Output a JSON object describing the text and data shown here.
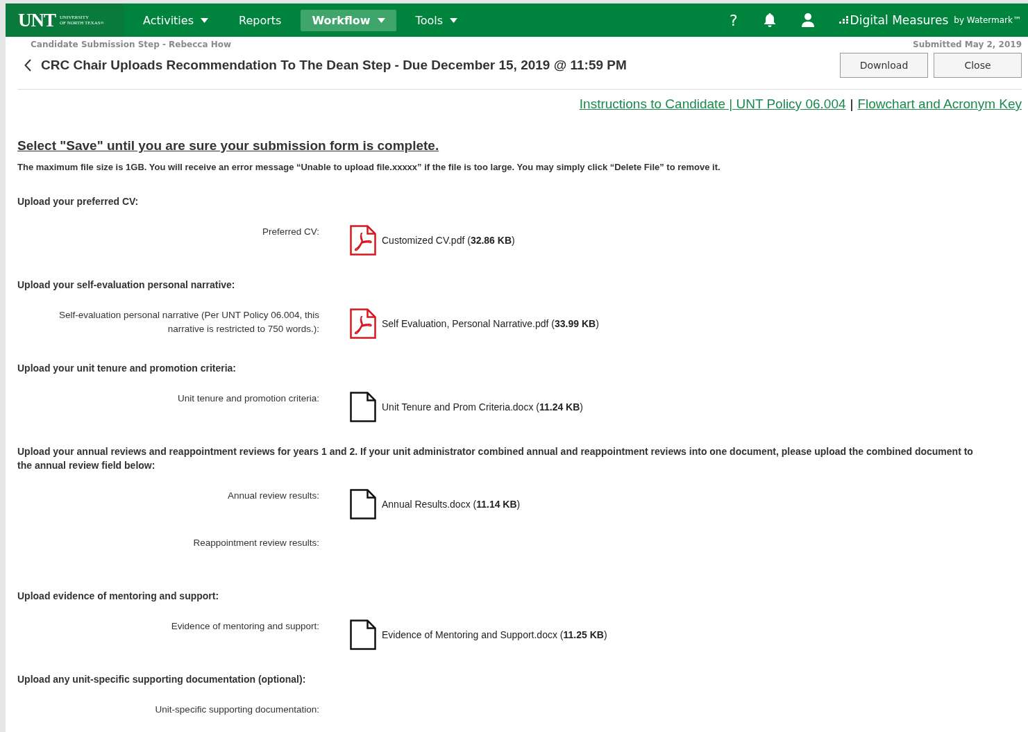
{
  "nav": {
    "logo": {
      "mark": "UNT",
      "line_1": "UNIVERSITY",
      "line_2": "OF NORTH TEXAS®"
    },
    "menu": [
      {
        "label": "Activities",
        "dropdown": true,
        "selected": false
      },
      {
        "label": "Reports",
        "dropdown": false,
        "selected": false
      },
      {
        "label": "Workflow",
        "dropdown": true,
        "selected": true
      },
      {
        "label": "Tools",
        "dropdown": true,
        "selected": false
      }
    ],
    "help": "?",
    "brand": "Digital Measures",
    "brand_by": "by Watermark™"
  },
  "header": {
    "previous_step": "Candidate Submission Step - Rebecca How",
    "submitted": "Submitted May 2, 2019",
    "title": "CRC Chair Uploads Recommendation To The Dean Step - Due December 15, 2019 @ 11:59 PM",
    "buttons": [
      "Download",
      "Close"
    ]
  },
  "links": [
    {
      "label": "Instructions to Candidate | UNT Policy 06.004"
    },
    {
      "label": "Flowchart and Acronym Key"
    }
  ],
  "link_separator": "|",
  "notice": "Select \"Save\" until you are sure your submission form is complete.",
  "file_size_note": "The maximum file size is 1GB.  You will receive an error message “Unable to upload file.xxxxx” if the file is too large. You may simply click “Delete File” to remove it.",
  "sections": [
    {
      "heading": "Upload your preferred CV:",
      "fields": [
        {
          "label": "Preferred CV:",
          "file": {
            "kind": "pdf",
            "name": "Customized CV.pdf (**32.86 KB**)"
          }
        }
      ]
    },
    {
      "heading": "Upload your self-evaluation personal narrative:",
      "fields": [
        {
          "label": "Self-evaluation personal narrative (Per UNT Policy 06.004, this narrative is restricted to 750 words.):",
          "file": {
            "kind": "pdf",
            "name": "Self Evaluation, Personal Narrative.pdf (**33.99 KB**)"
          }
        }
      ]
    },
    {
      "heading": "Upload your unit tenure and promotion criteria:",
      "fields": [
        {
          "label": "Unit tenure and promotion criteria:",
          "file": {
            "kind": "doc",
            "name": "Unit Tenure and Prom Criteria.docx (**11.24 KB**)"
          }
        }
      ]
    },
    {
      "heading": "Upload your annual reviews and reappointment reviews for years 1 and 2.  If  your unit administrator combined annual and reappointment reviews into one document, please upload the combined document to the annual review field below:",
      "fields": [
        {
          "label": "Annual review results:",
          "file": {
            "kind": "doc",
            "name": "Annual Results.docx (**11.14 KB**)"
          }
        },
        {
          "label": "Reappointment review results:"
        }
      ]
    },
    {
      "heading": "Upload evidence of mentoring and support:",
      "fields": [
        {
          "label": "Evidence of mentoring and support:",
          "file": {
            "kind": "doc",
            "name": "Evidence of Mentoring and Support.docx (**11.25 KB**)"
          }
        }
      ]
    },
    {
      "heading": "Upload any unit-specific supporting documentation (optional):",
      "fields": [
        {
          "label": "Unit-specific supporting documentation:"
        }
      ]
    }
  ]
}
